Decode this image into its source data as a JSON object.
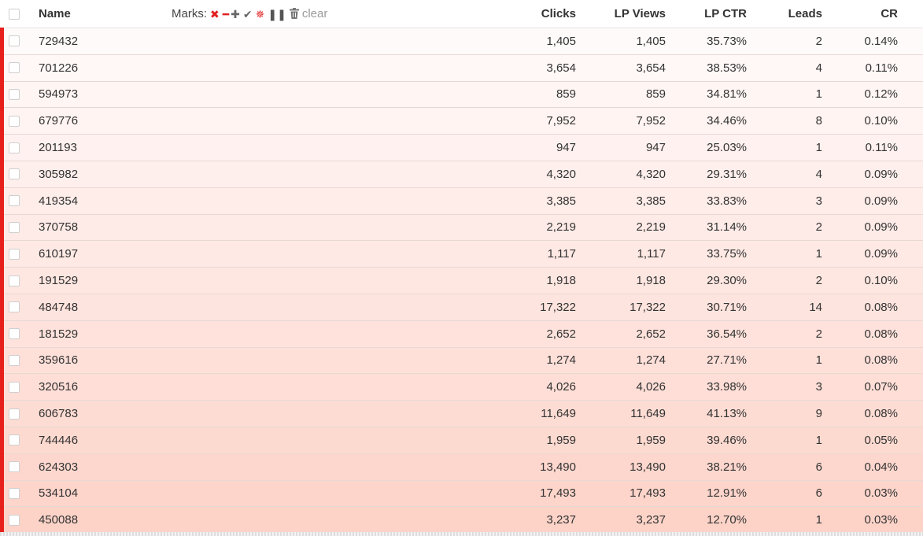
{
  "header": {
    "name": "Name",
    "marks_label": "Marks:",
    "marks_icons": [
      "x-icon",
      "minus-icon",
      "plus-icon",
      "check-icon",
      "star-icon",
      "pause-icon",
      "trash-icon"
    ],
    "clear": "clear",
    "clicks": "Clicks",
    "lp_views": "LP Views",
    "lp_ctr": "LP CTR",
    "leads": "Leads",
    "cr": "CR"
  },
  "colors": {
    "accent_red": "#e8201c",
    "row_gradient_top": "#fffafa",
    "row_gradient_bottom": "#fdd3c8"
  },
  "rows": [
    {
      "name": "729432",
      "clicks": "1,405",
      "lp_views": "1,405",
      "lp_ctr": "35.73%",
      "leads": "2",
      "cr": "0.14%"
    },
    {
      "name": "701226",
      "clicks": "3,654",
      "lp_views": "3,654",
      "lp_ctr": "38.53%",
      "leads": "4",
      "cr": "0.11%"
    },
    {
      "name": "594973",
      "clicks": "859",
      "lp_views": "859",
      "lp_ctr": "34.81%",
      "leads": "1",
      "cr": "0.12%"
    },
    {
      "name": "679776",
      "clicks": "7,952",
      "lp_views": "7,952",
      "lp_ctr": "34.46%",
      "leads": "8",
      "cr": "0.10%"
    },
    {
      "name": "201193",
      "clicks": "947",
      "lp_views": "947",
      "lp_ctr": "25.03%",
      "leads": "1",
      "cr": "0.11%"
    },
    {
      "name": "305982",
      "clicks": "4,320",
      "lp_views": "4,320",
      "lp_ctr": "29.31%",
      "leads": "4",
      "cr": "0.09%"
    },
    {
      "name": "419354",
      "clicks": "3,385",
      "lp_views": "3,385",
      "lp_ctr": "33.83%",
      "leads": "3",
      "cr": "0.09%"
    },
    {
      "name": "370758",
      "clicks": "2,219",
      "lp_views": "2,219",
      "lp_ctr": "31.14%",
      "leads": "2",
      "cr": "0.09%"
    },
    {
      "name": "610197",
      "clicks": "1,117",
      "lp_views": "1,117",
      "lp_ctr": "33.75%",
      "leads": "1",
      "cr": "0.09%"
    },
    {
      "name": "191529",
      "clicks": "1,918",
      "lp_views": "1,918",
      "lp_ctr": "29.30%",
      "leads": "2",
      "cr": "0.10%"
    },
    {
      "name": "484748",
      "clicks": "17,322",
      "lp_views": "17,322",
      "lp_ctr": "30.71%",
      "leads": "14",
      "cr": "0.08%"
    },
    {
      "name": "181529",
      "clicks": "2,652",
      "lp_views": "2,652",
      "lp_ctr": "36.54%",
      "leads": "2",
      "cr": "0.08%"
    },
    {
      "name": "359616",
      "clicks": "1,274",
      "lp_views": "1,274",
      "lp_ctr": "27.71%",
      "leads": "1",
      "cr": "0.08%"
    },
    {
      "name": "320516",
      "clicks": "4,026",
      "lp_views": "4,026",
      "lp_ctr": "33.98%",
      "leads": "3",
      "cr": "0.07%"
    },
    {
      "name": "606783",
      "clicks": "11,649",
      "lp_views": "11,649",
      "lp_ctr": "41.13%",
      "leads": "9",
      "cr": "0.08%"
    },
    {
      "name": "744446",
      "clicks": "1,959",
      "lp_views": "1,959",
      "lp_ctr": "39.46%",
      "leads": "1",
      "cr": "0.05%"
    },
    {
      "name": "624303",
      "clicks": "13,490",
      "lp_views": "13,490",
      "lp_ctr": "38.21%",
      "leads": "6",
      "cr": "0.04%"
    },
    {
      "name": "534104",
      "clicks": "17,493",
      "lp_views": "17,493",
      "lp_ctr": "12.91%",
      "leads": "6",
      "cr": "0.03%"
    },
    {
      "name": "450088",
      "clicks": "3,237",
      "lp_views": "3,237",
      "lp_ctr": "12.70%",
      "leads": "1",
      "cr": "0.03%"
    }
  ]
}
